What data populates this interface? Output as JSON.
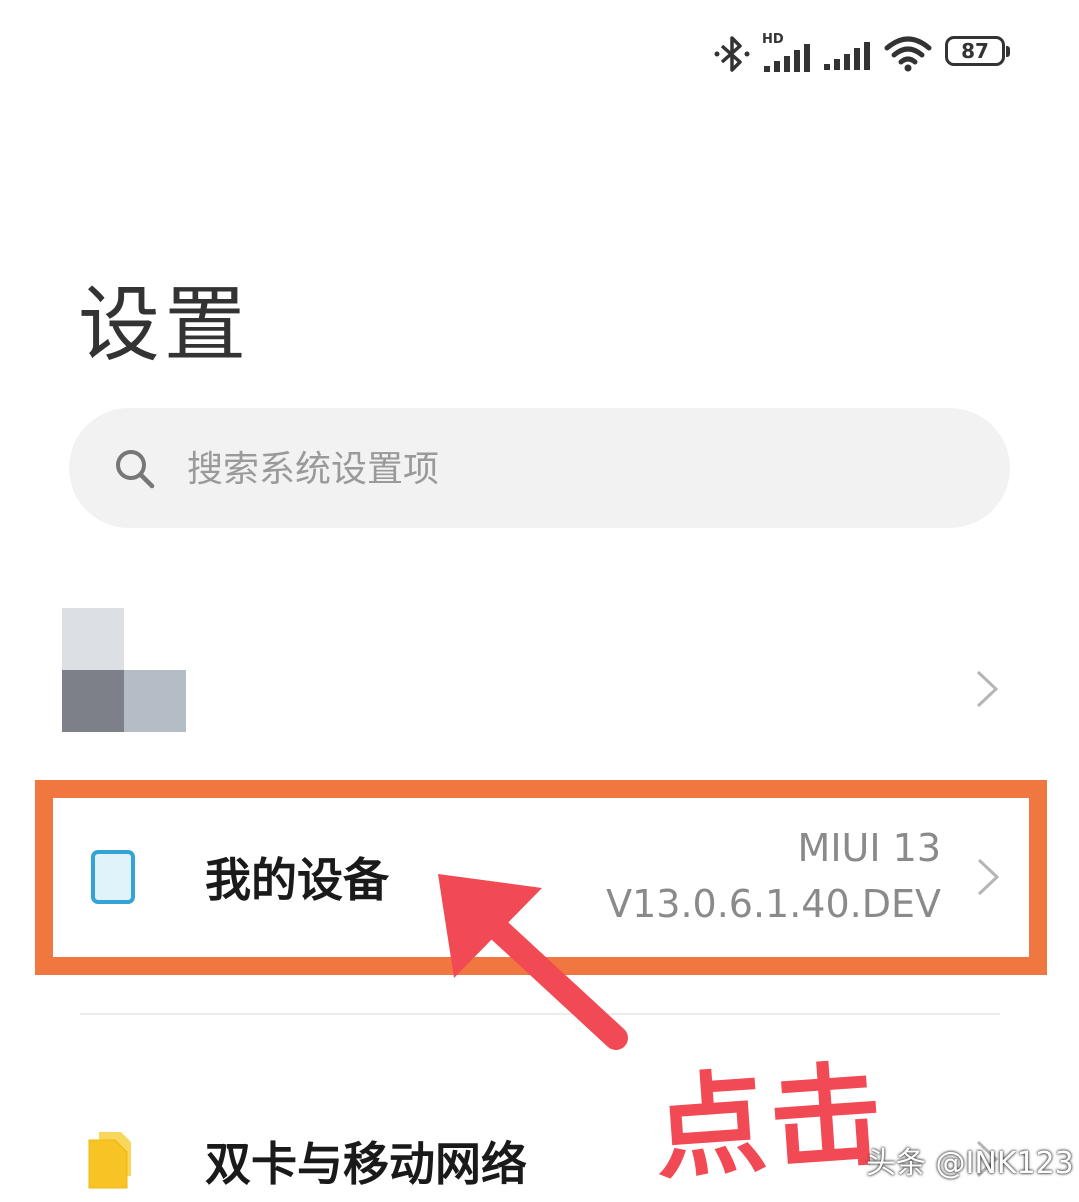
{
  "status_bar": {
    "signal_type": "HD",
    "battery": "87",
    "icons": [
      "bluetooth-icon",
      "signal-hd-icon",
      "signal-icon",
      "wifi-icon",
      "battery-icon"
    ]
  },
  "page": {
    "title": "设置"
  },
  "search": {
    "placeholder": "搜索系统设置项",
    "value": ""
  },
  "items": {
    "my_device": {
      "label": "我的设备",
      "os_name": "MIUI 13",
      "os_version": "V13.0.6.1.40.DEV"
    },
    "dual_sim": {
      "label": "双卡与移动网络"
    }
  },
  "annotation": {
    "text": "点击",
    "highlight_color": "#f07840",
    "arrow_color": "#f24a55"
  },
  "watermark": {
    "text": "头条 @INK123"
  },
  "colors": {
    "device_icon": "#35a3d6",
    "sim_icon": "#f7c325"
  }
}
